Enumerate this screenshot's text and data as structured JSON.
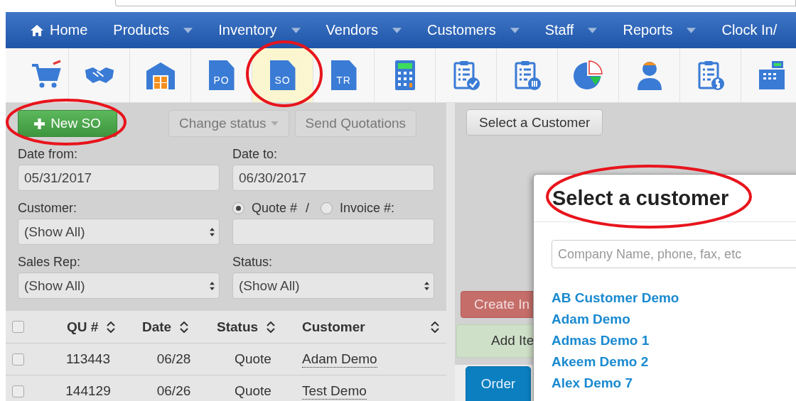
{
  "nav": [
    {
      "label": "Home",
      "kind": "home",
      "dropdown": false
    },
    {
      "label": "Products",
      "kind": "menu",
      "dropdown": true
    },
    {
      "label": "Inventory",
      "kind": "menu",
      "dropdown": true
    },
    {
      "label": "Vendors",
      "kind": "menu",
      "dropdown": true
    },
    {
      "label": "Customers",
      "kind": "menu",
      "dropdown": true
    },
    {
      "label": "Staff",
      "kind": "menu",
      "dropdown": true
    },
    {
      "label": "Reports",
      "kind": "menu",
      "dropdown": true
    },
    {
      "label": "Clock In/",
      "kind": "menu",
      "dropdown": false
    }
  ],
  "toolbar": [
    {
      "kind": "cart",
      "selected": false
    },
    {
      "kind": "handshake",
      "selected": false
    },
    {
      "kind": "warehouse",
      "selected": false
    },
    {
      "kind": "doc",
      "label": "PO",
      "selected": false
    },
    {
      "kind": "doc",
      "label": "SO",
      "selected": true
    },
    {
      "kind": "doc",
      "label": "TR",
      "selected": false
    },
    {
      "kind": "calculator",
      "selected": false
    },
    {
      "kind": "clipboard-check",
      "selected": false
    },
    {
      "kind": "clipboard-list",
      "selected": false
    },
    {
      "kind": "pie",
      "selected": false
    },
    {
      "kind": "person",
      "selected": false
    },
    {
      "kind": "clipboard-dollar",
      "selected": false
    },
    {
      "kind": "register",
      "selected": false
    }
  ],
  "actions": [
    {
      "label": "New SO",
      "kind": "primary",
      "disabled": false
    },
    {
      "label": "Change status",
      "kind": "dropdown",
      "disabled": true
    },
    {
      "label": "Send Quotations",
      "kind": "plain",
      "disabled": true
    }
  ],
  "filters": {
    "date_from": {
      "label": "Date from:",
      "value": "05/31/2017"
    },
    "date_to": {
      "label": "Date to:",
      "value": "06/30/2017"
    },
    "customer": {
      "label": "Customer:",
      "value": "(Show All)"
    },
    "number_type": [
      {
        "label": "Quote #",
        "selected": true
      },
      {
        "label": "Invoice #:",
        "selected": false
      }
    ],
    "number_separator": "/",
    "sales_rep": {
      "label": "Sales Rep:",
      "value": "(Show All)"
    },
    "status": {
      "label": "Status:",
      "value": "(Show All)"
    }
  },
  "table": {
    "all_checked": false,
    "columns": [
      "QU #",
      "Date",
      "Status",
      "Customer"
    ],
    "rows": [
      {
        "checked": false,
        "cells": [
          "113443",
          "06/28",
          "Quote",
          "Adam Demo"
        ]
      },
      {
        "checked": false,
        "cells": [
          "144129",
          "06/26",
          "Quote",
          "Test Demo"
        ]
      }
    ]
  },
  "right": {
    "select_button": "Select a Customer",
    "create_button": "Create In",
    "add_button": "Add Ite",
    "order_tab": "Order"
  },
  "modal": {
    "title": "Select a customer",
    "search": {
      "placeholder": "Company Name, phone, fax, etc"
    },
    "customers": [
      "AB Customer Demo",
      "Adam Demo",
      "Admas Demo 1",
      "Akeem Demo 2",
      "Alex Demo 7"
    ]
  }
}
